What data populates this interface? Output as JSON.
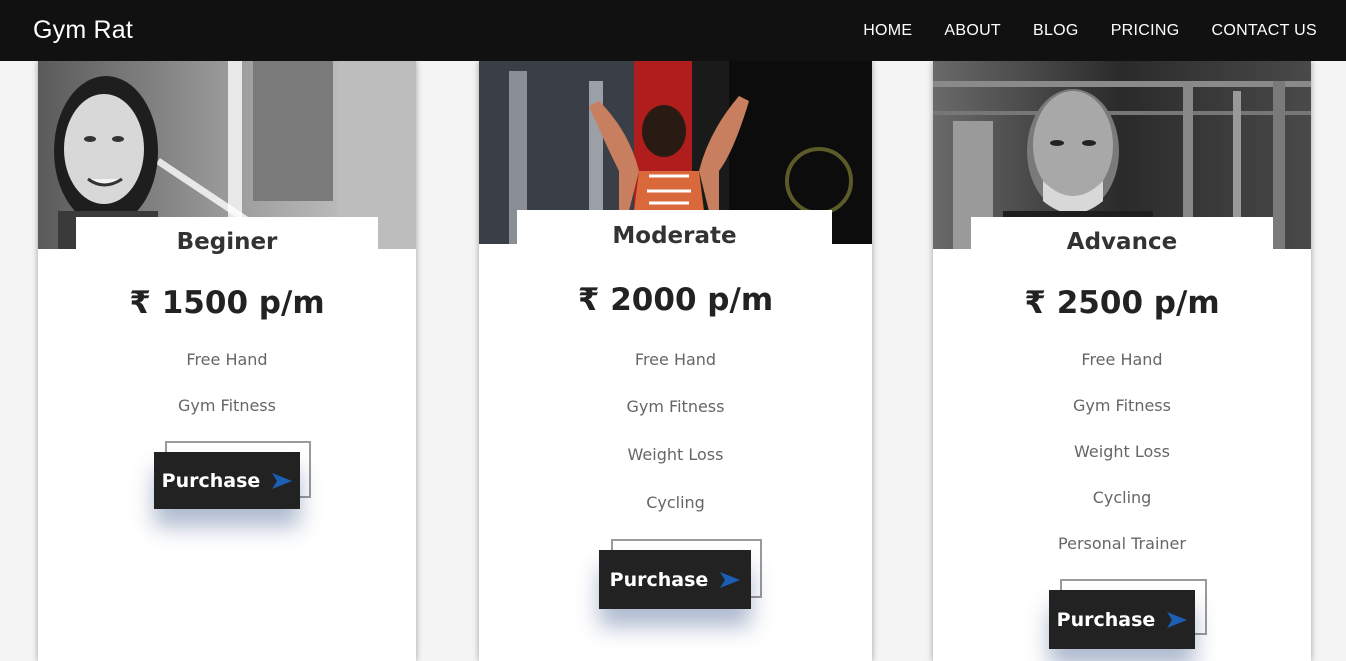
{
  "brand": "Gym Rat",
  "nav": [
    "HOME",
    "ABOUT",
    "BLOG",
    "PRICING",
    "CONTACT US"
  ],
  "colors": {
    "navbar": "#111111",
    "button": "#222222",
    "arrow": "#1a5fb4"
  },
  "plans": [
    {
      "title": "Beginer",
      "price": "₹ 1500 p/m",
      "features": [
        "Free Hand",
        "Gym Fitness"
      ],
      "button": "Purchase"
    },
    {
      "title": "Moderate",
      "price": "₹ 2000 p/m",
      "features": [
        "Free Hand",
        "Gym Fitness",
        "Weight Loss",
        "Cycling"
      ],
      "button": "Purchase"
    },
    {
      "title": "Advance",
      "price": "₹ 2500 p/m",
      "features": [
        "Free Hand",
        "Gym Fitness",
        "Weight Loss",
        "Cycling",
        "Personal Trainer"
      ],
      "button": "Purchase"
    }
  ]
}
